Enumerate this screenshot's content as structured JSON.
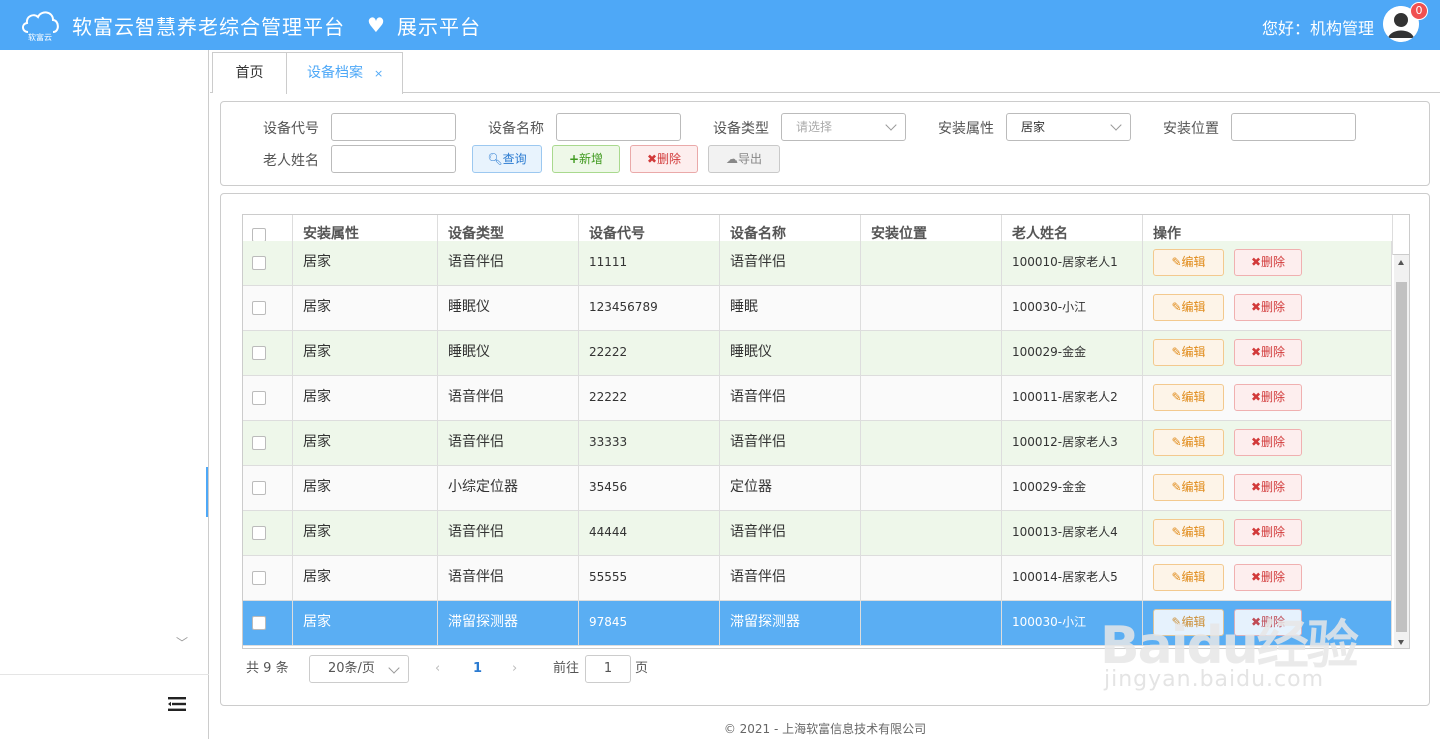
{
  "header": {
    "logo_text": "软富云",
    "title": "软富云智慧养老综合管理平台",
    "subtitle": "展示平台",
    "greeting": "您好：机构管理",
    "notification_count": "0"
  },
  "tabs": [
    {
      "label": "首页"
    },
    {
      "label": "设备档案",
      "close": "×"
    }
  ],
  "filters": {
    "device_code_label": "设备代号",
    "device_code_value": "",
    "device_name_label": "设备名称",
    "device_name_value": "",
    "device_type_label": "设备类型",
    "device_type_placeholder": "请选择",
    "install_attr_label": "安装属性",
    "install_attr_value": "居家",
    "install_location_label": "安装位置",
    "install_location_value": "",
    "elder_name_label": "老人姓名",
    "elder_name_value": ""
  },
  "toolbar": {
    "query": "查询",
    "add": "新增",
    "delete": "删除",
    "export": "导出"
  },
  "table": {
    "columns": [
      "安装属性",
      "设备类型",
      "设备代号",
      "设备名称",
      "安装位置",
      "老人姓名",
      "操作"
    ],
    "edit_label": "编辑",
    "delete_label": "删除",
    "rows": [
      {
        "attr": "居家",
        "type": "语音伴侣",
        "code": "11111",
        "name": "语音伴侣",
        "location": "",
        "elder": "100010-居家老人1"
      },
      {
        "attr": "居家",
        "type": "睡眠仪",
        "code": "123456789",
        "name": "睡眠",
        "location": "",
        "elder": "100030-小江"
      },
      {
        "attr": "居家",
        "type": "睡眠仪",
        "code": "22222",
        "name": "睡眠仪",
        "location": "",
        "elder": "100029-金金"
      },
      {
        "attr": "居家",
        "type": "语音伴侣",
        "code": "22222",
        "name": "语音伴侣",
        "location": "",
        "elder": "100011-居家老人2"
      },
      {
        "attr": "居家",
        "type": "语音伴侣",
        "code": "33333",
        "name": "语音伴侣",
        "location": "",
        "elder": "100012-居家老人3"
      },
      {
        "attr": "居家",
        "type": "小综定位器",
        "code": "35456",
        "name": "定位器",
        "location": "",
        "elder": "100029-金金"
      },
      {
        "attr": "居家",
        "type": "语音伴侣",
        "code": "44444",
        "name": "语音伴侣",
        "location": "",
        "elder": "100013-居家老人4"
      },
      {
        "attr": "居家",
        "type": "语音伴侣",
        "code": "55555",
        "name": "语音伴侣",
        "location": "",
        "elder": "100014-居家老人5"
      },
      {
        "attr": "居家",
        "type": "滞留探测器",
        "code": "97845",
        "name": "滞留探测器",
        "location": "",
        "elder": "100030-小江"
      }
    ]
  },
  "pager": {
    "total_prefix": "共",
    "total": "9",
    "total_suffix": "条",
    "page_size": "20条/页",
    "current_page": "1",
    "goto_label": "前往",
    "goto_value": "1",
    "goto_suffix": "页"
  },
  "footer": {
    "text": "© 2021 - 上海软富信息技术有限公司"
  },
  "watermark": {
    "brand": "Baidu经验",
    "url": "jingyan.baidu.com"
  }
}
